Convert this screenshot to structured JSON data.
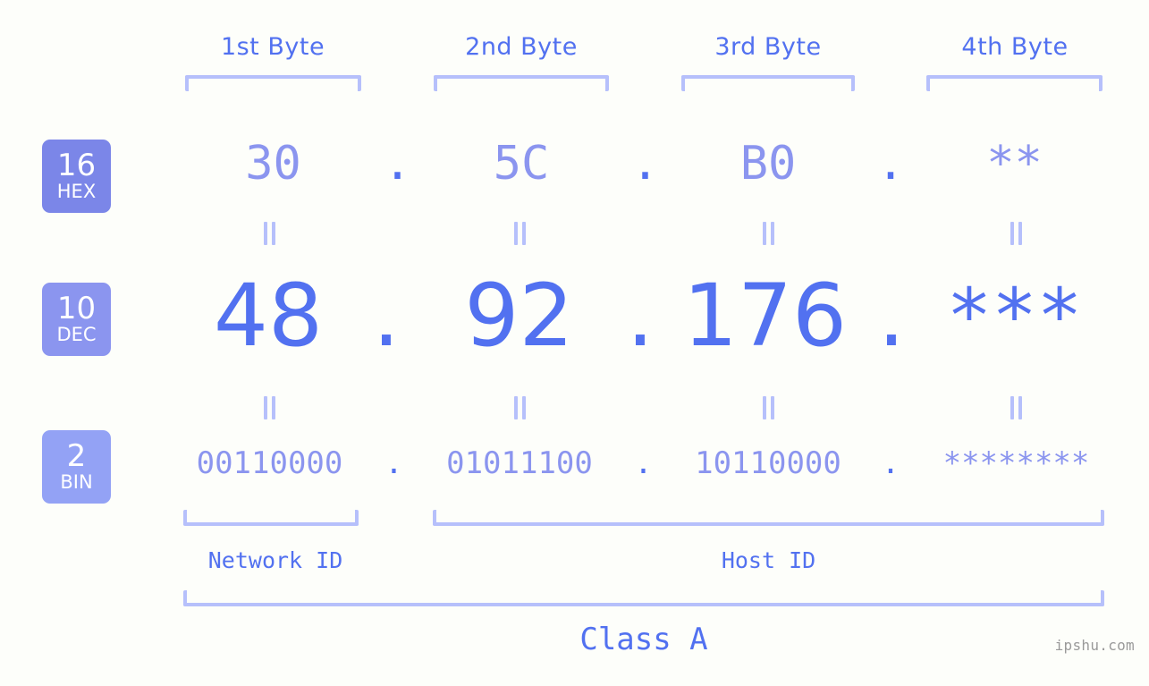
{
  "background_color": "#fdfefa",
  "accent_color": "#5271f0",
  "muted_color": "#8b95ef",
  "bracket_color": "#b6c0fb",
  "headers": {
    "byte1": "1st Byte",
    "byte2": "2nd Byte",
    "byte3": "3rd Byte",
    "byte4": "4th Byte"
  },
  "radix_badges": [
    {
      "number": "16",
      "label": "HEX",
      "color": "#7b86e8"
    },
    {
      "number": "10",
      "label": "DEC",
      "color": "#8b95ef"
    },
    {
      "number": "2",
      "label": "BIN",
      "color": "#93a2f5"
    }
  ],
  "separator": ".",
  "equals_marker": "=",
  "rows": {
    "hex": {
      "radix": "16",
      "radix_label": "HEX",
      "octets": [
        "30",
        "5C",
        "B0",
        "**"
      ]
    },
    "dec": {
      "radix": "10",
      "radix_label": "DEC",
      "octets": [
        "48",
        "92",
        "176",
        "***"
      ]
    },
    "bin": {
      "radix": "2",
      "radix_label": "BIN",
      "octets": [
        "00110000",
        "01011100",
        "10110000",
        "********"
      ]
    }
  },
  "sections": {
    "network_id": "Network ID",
    "host_id": "Host ID",
    "class": "Class A"
  },
  "watermark": "ipshu.com"
}
